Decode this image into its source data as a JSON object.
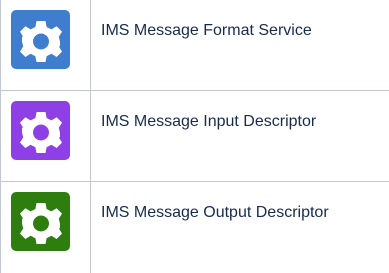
{
  "services": [
    {
      "label": "IMS Message Format Service",
      "icon": "gear-icon",
      "color": "#3f7dcf"
    },
    {
      "label": "IMS Message Input Descriptor",
      "icon": "gear-icon",
      "color": "#8f3fe6"
    },
    {
      "label": "IMS Message Output Descriptor",
      "icon": "gear-icon",
      "color": "#2e7d0f"
    }
  ]
}
